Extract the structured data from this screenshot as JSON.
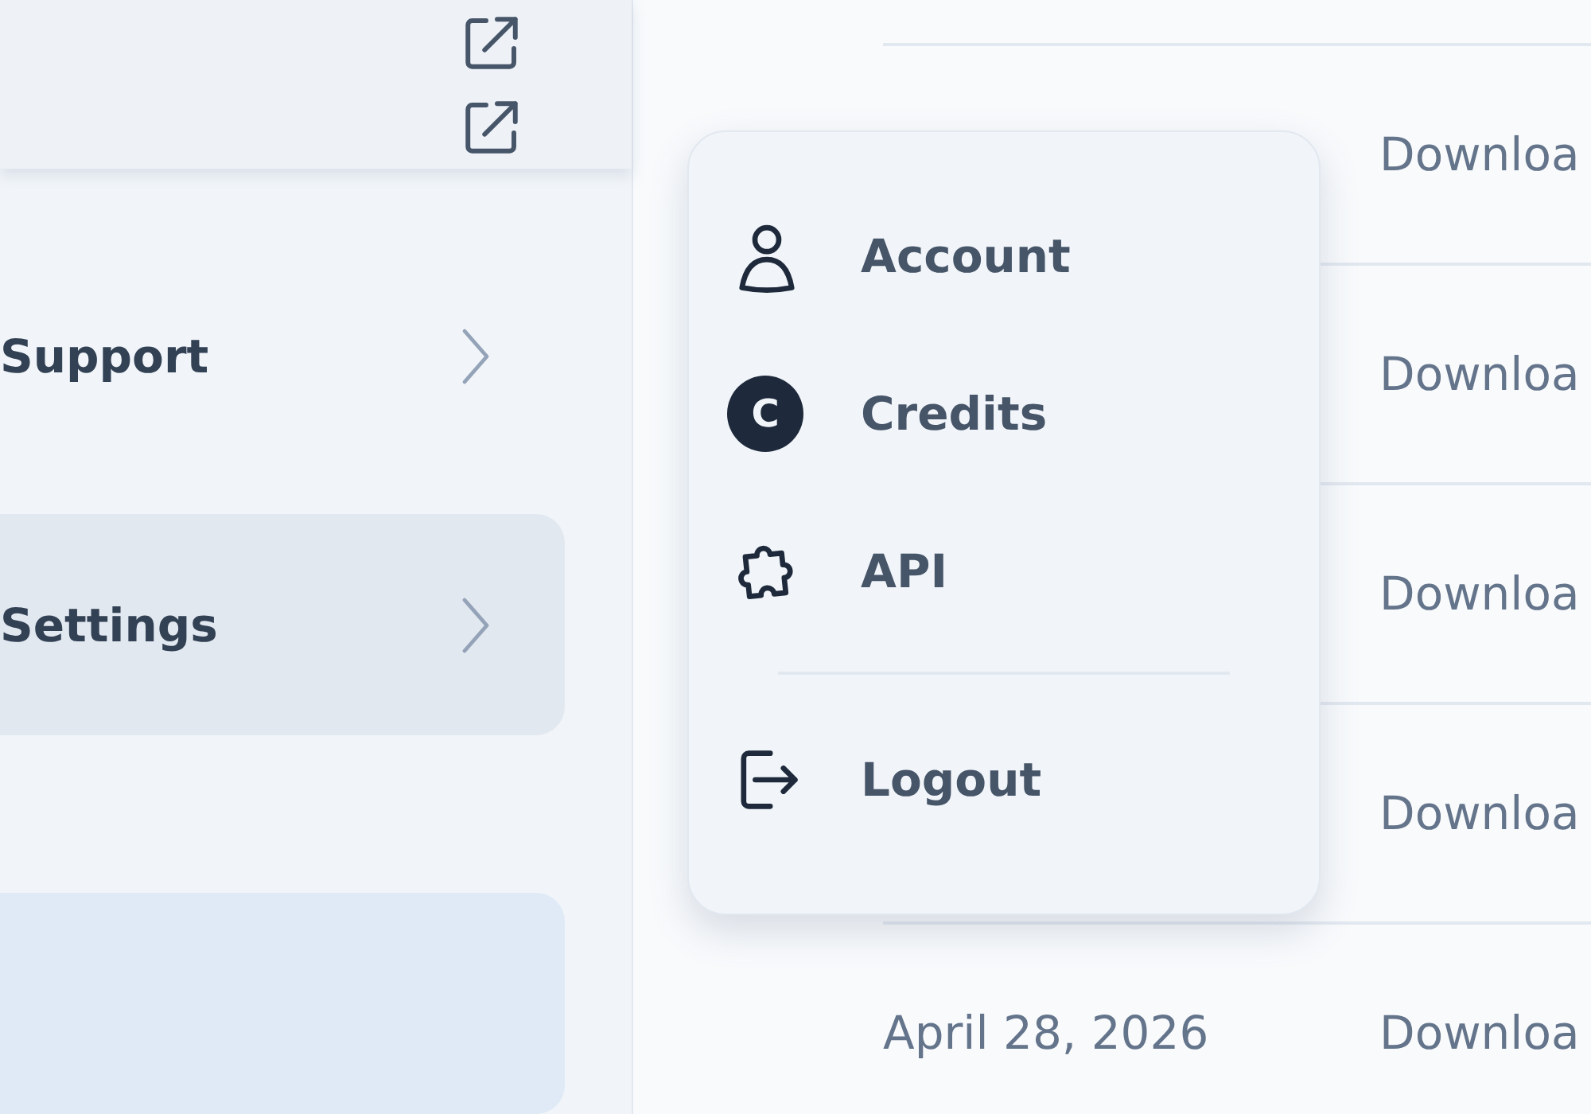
{
  "sidebar": {
    "items": [
      {
        "kind": "submenu",
        "label": "Support",
        "selected": false
      },
      {
        "kind": "submenu",
        "label": "Settings",
        "selected": true
      },
      {
        "kind": "accent",
        "selected": false
      }
    ]
  },
  "table": {
    "rows": [
      {
        "column_2": "Downloa"
      },
      {
        "column_2": "Downloa"
      },
      {
        "column_2": "Downloa"
      },
      {
        "column_2": "Downloa"
      },
      {
        "column_1": "April 28, 2026",
        "column_2": "Downloa"
      }
    ]
  },
  "menu": {
    "items": [
      {
        "kind": "account",
        "label": "Account"
      },
      {
        "kind": "credits",
        "label": "Credits",
        "icon_text": "C"
      },
      {
        "kind": "api",
        "label": "API"
      },
      {
        "kind": "divider"
      },
      {
        "kind": "logout",
        "label": "Logout"
      }
    ]
  }
}
